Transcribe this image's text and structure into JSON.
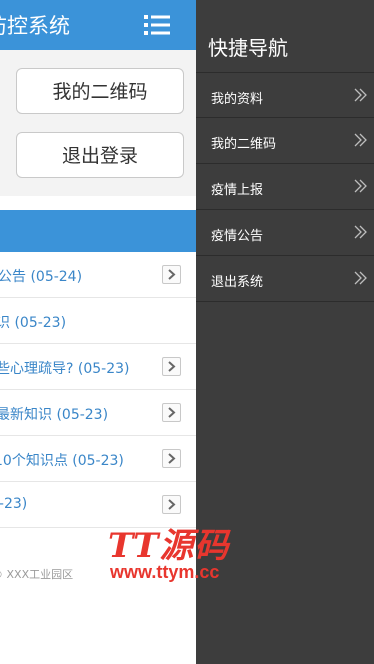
{
  "app": {
    "title": "防控系统",
    "menu_icon": "list-menu-icon"
  },
  "actions": {
    "qr_label": "我的二维码",
    "logout_label": "退出登录"
  },
  "news": [
    {
      "text": "公告 (05-24)"
    },
    {
      "text": "识 (05-23)"
    },
    {
      "text": "些心理疏导? (05-23)"
    },
    {
      "text": "最新知识 (05-23)"
    },
    {
      "text": "10个知识点 (05-23)"
    },
    {
      "text": "5-23)"
    }
  ],
  "footer": {
    "text": "© XXX工业园区"
  },
  "drawer": {
    "title": "快捷导航",
    "items": [
      {
        "label": "我的资料"
      },
      {
        "label": "我的二维码"
      },
      {
        "label": "疫情上报"
      },
      {
        "label": "疫情公告"
      },
      {
        "label": "退出系统"
      }
    ]
  },
  "watermark": {
    "logo": "TT源码",
    "url": "www.ttym.cc"
  },
  "colors": {
    "primary": "#3b93d9",
    "drawer_bg": "#3d3d3d",
    "link": "#3a86c8",
    "watermark": "#e8362e"
  }
}
